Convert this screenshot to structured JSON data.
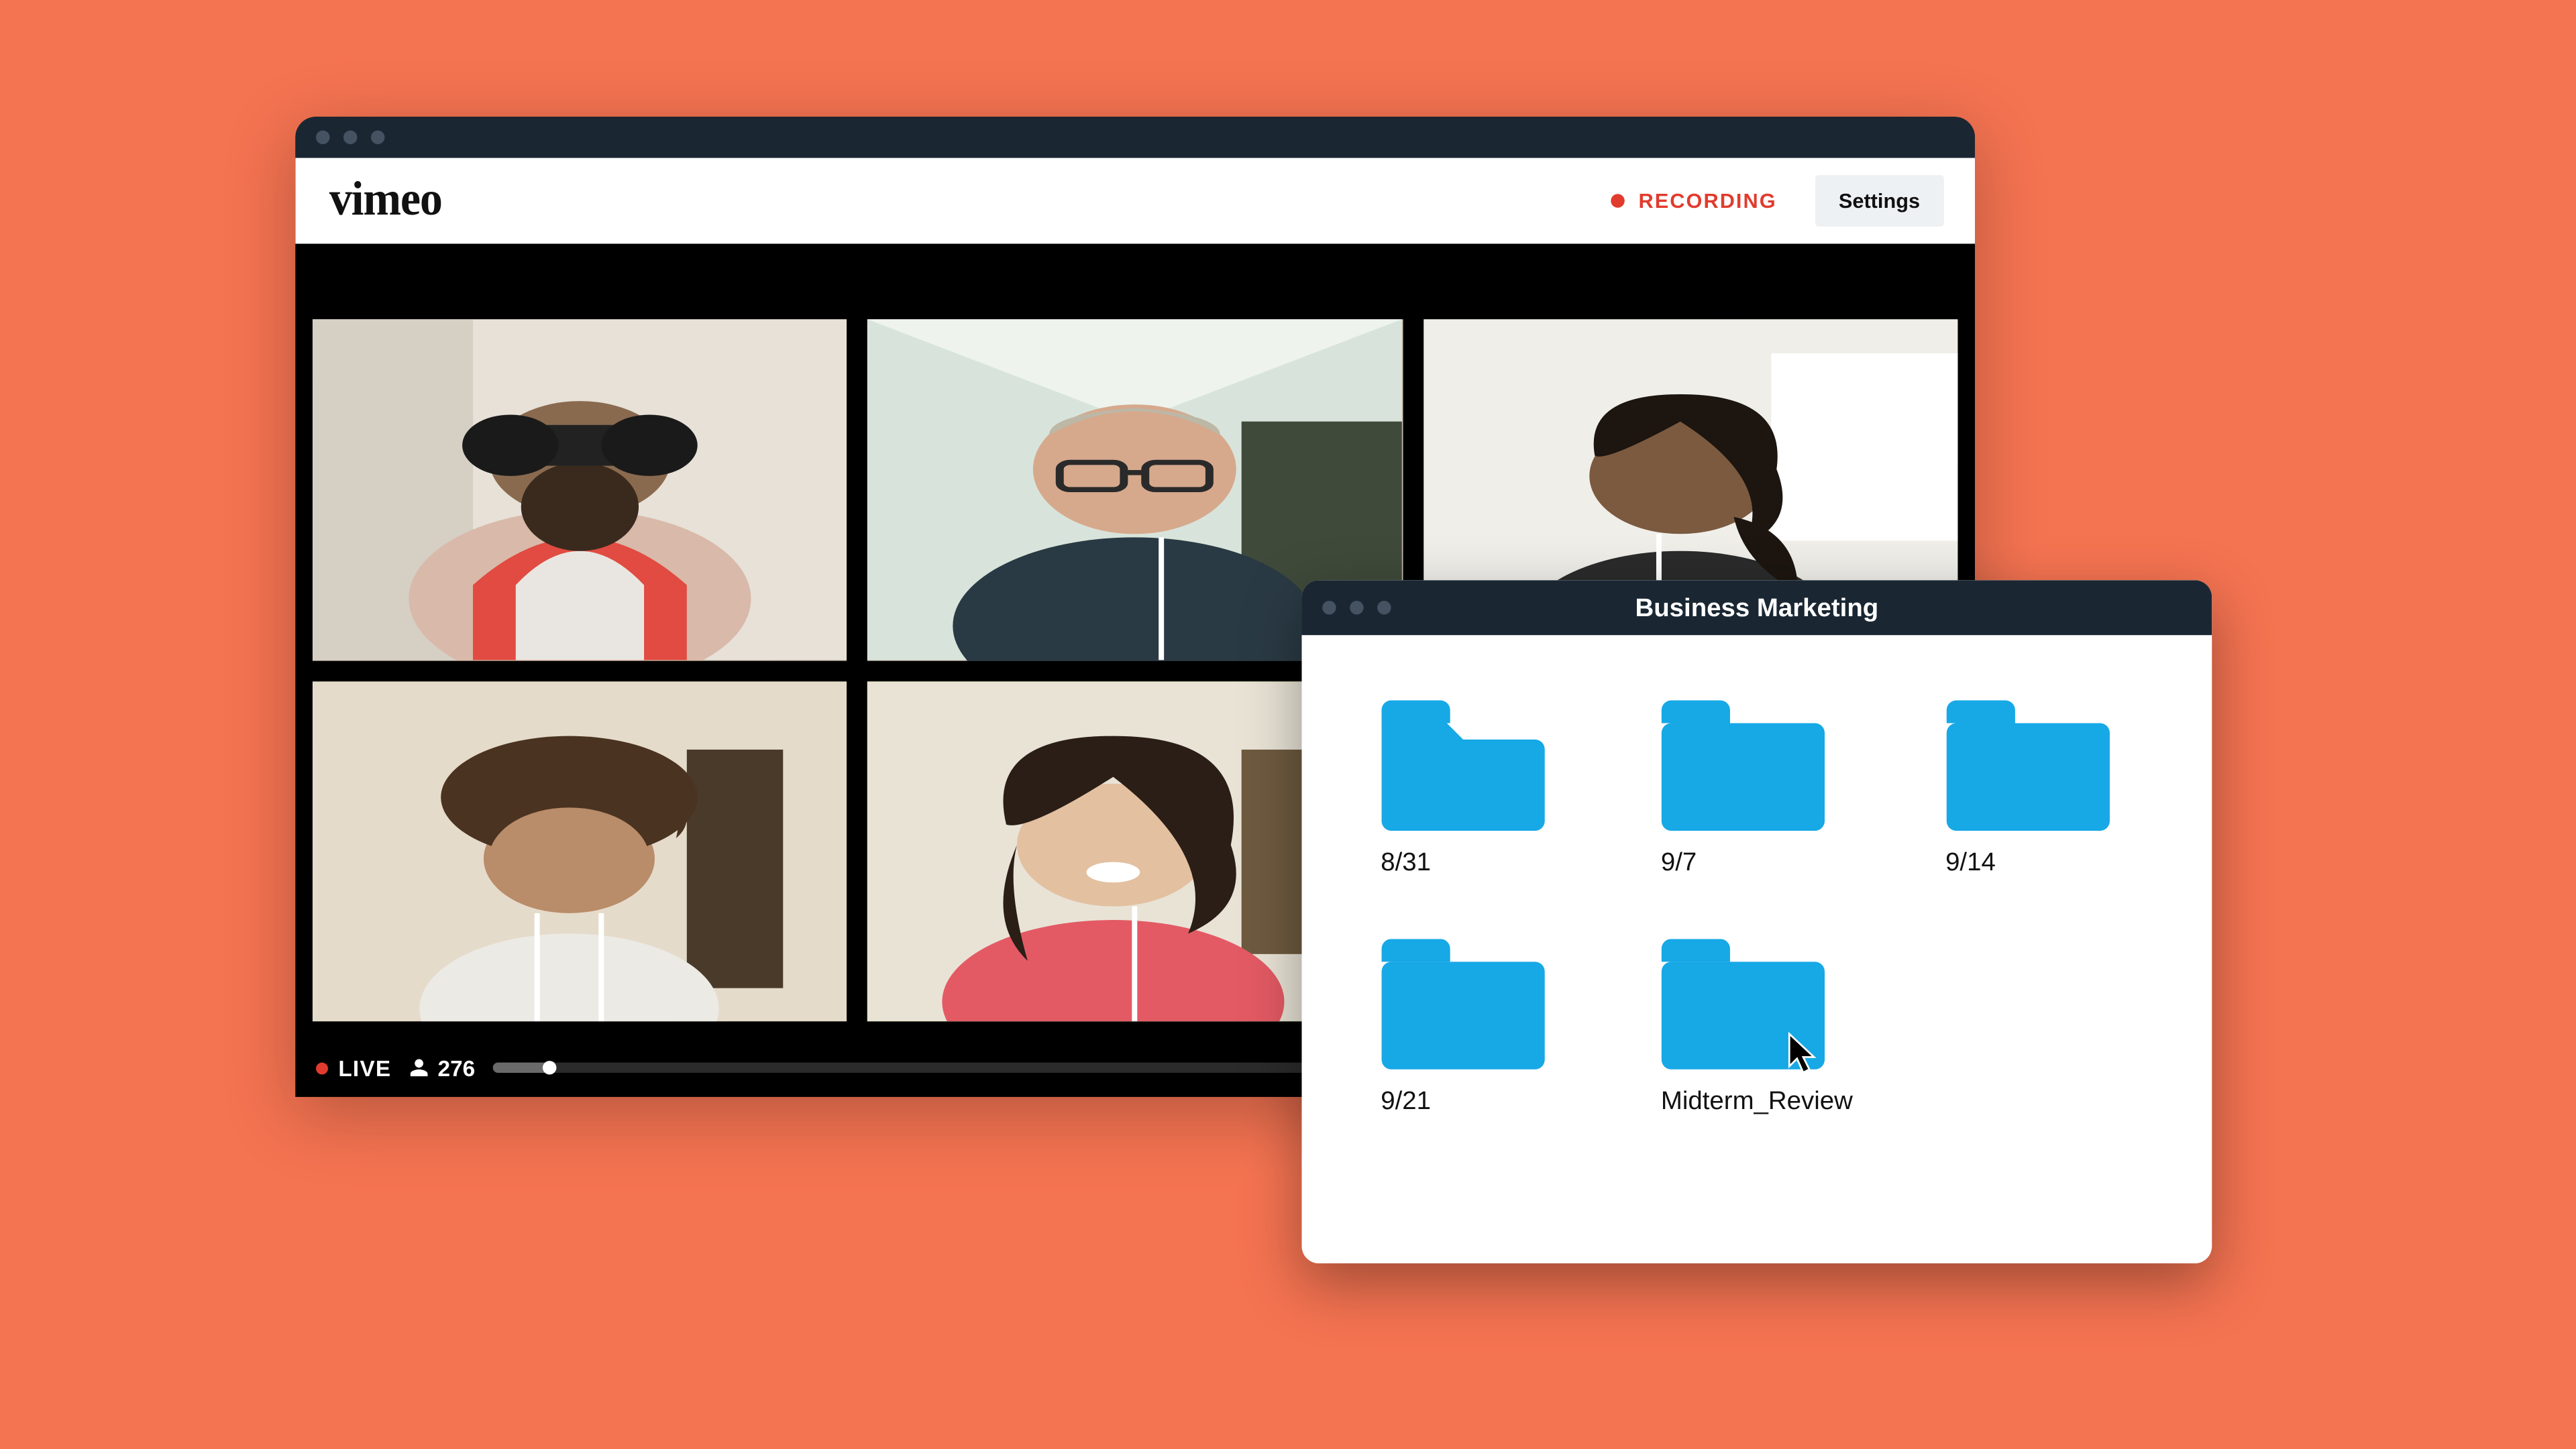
{
  "colors": {
    "background": "#f47351",
    "titlebar": "#1a2733",
    "record": "#e13b2e",
    "folder": "#17a8e6"
  },
  "main_window": {
    "brand": "vimeo",
    "recording_label": "RECORDING",
    "settings_label": "Settings",
    "live_label": "LIVE",
    "viewer_count": "276",
    "tiles": [
      {
        "id": "participant-1",
        "active": false
      },
      {
        "id": "participant-2",
        "active": false
      },
      {
        "id": "participant-3",
        "active": false
      },
      {
        "id": "participant-4",
        "active": false
      },
      {
        "id": "participant-5",
        "active": true
      }
    ]
  },
  "folder_window": {
    "title": "Business Marketing",
    "folders": [
      {
        "label": "8/31"
      },
      {
        "label": "9/7"
      },
      {
        "label": "9/14"
      },
      {
        "label": "9/21"
      },
      {
        "label": "Midterm_Review"
      }
    ]
  }
}
